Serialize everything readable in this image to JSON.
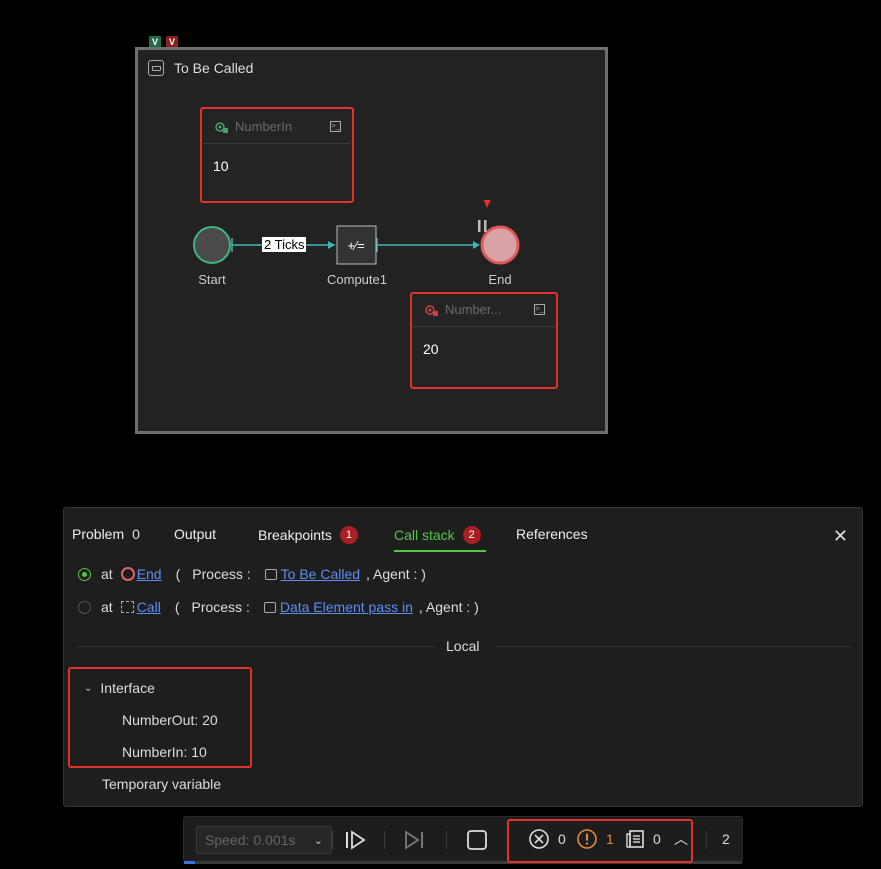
{
  "canvas": {
    "badges": [
      "V",
      "V"
    ],
    "process_title": "To Be Called",
    "number_in_card": {
      "label": "NumberIn",
      "value": "10"
    },
    "number_out_card": {
      "label": "Number...",
      "value": "20"
    },
    "link_label": "2 Ticks",
    "nodes": {
      "start": "Start",
      "compute": "Compute1",
      "end": "End"
    }
  },
  "panel": {
    "tabs": [
      {
        "label": "Problem",
        "count": "0"
      },
      {
        "label": "Output"
      },
      {
        "label": "Breakpoints",
        "count": "1"
      },
      {
        "label": "Call stack",
        "count": "2"
      },
      {
        "label": "References"
      }
    ],
    "call_stack": [
      {
        "at": "at",
        "node": "End",
        "open_paren": "(",
        "process_label": "Process :",
        "process": "To Be Called",
        "agent": ", Agent : )"
      },
      {
        "at": "at",
        "node": "Call",
        "open_paren": "(",
        "process_label": "Process :",
        "process": "Data Element pass in",
        "agent": ", Agent : )"
      }
    ],
    "local_label": "Local",
    "interface_label": "Interface",
    "variables": [
      {
        "text": "NumberOut: 20"
      },
      {
        "text": "NumberIn: 10"
      }
    ],
    "temporary_label": "Temporary variable"
  },
  "toolbar": {
    "speed_label": "Speed:",
    "speed_value": "0.001s",
    "errors": "0",
    "warnings": "1",
    "logs": "0",
    "count": "2",
    "progress": 0.02
  },
  "colors": {
    "accent_green": "#55c447",
    "badge_red": "#a81f25",
    "highlight_red": "#e5312b",
    "link_blue": "#5e8df5",
    "connector_teal": "#3fb6b6"
  }
}
